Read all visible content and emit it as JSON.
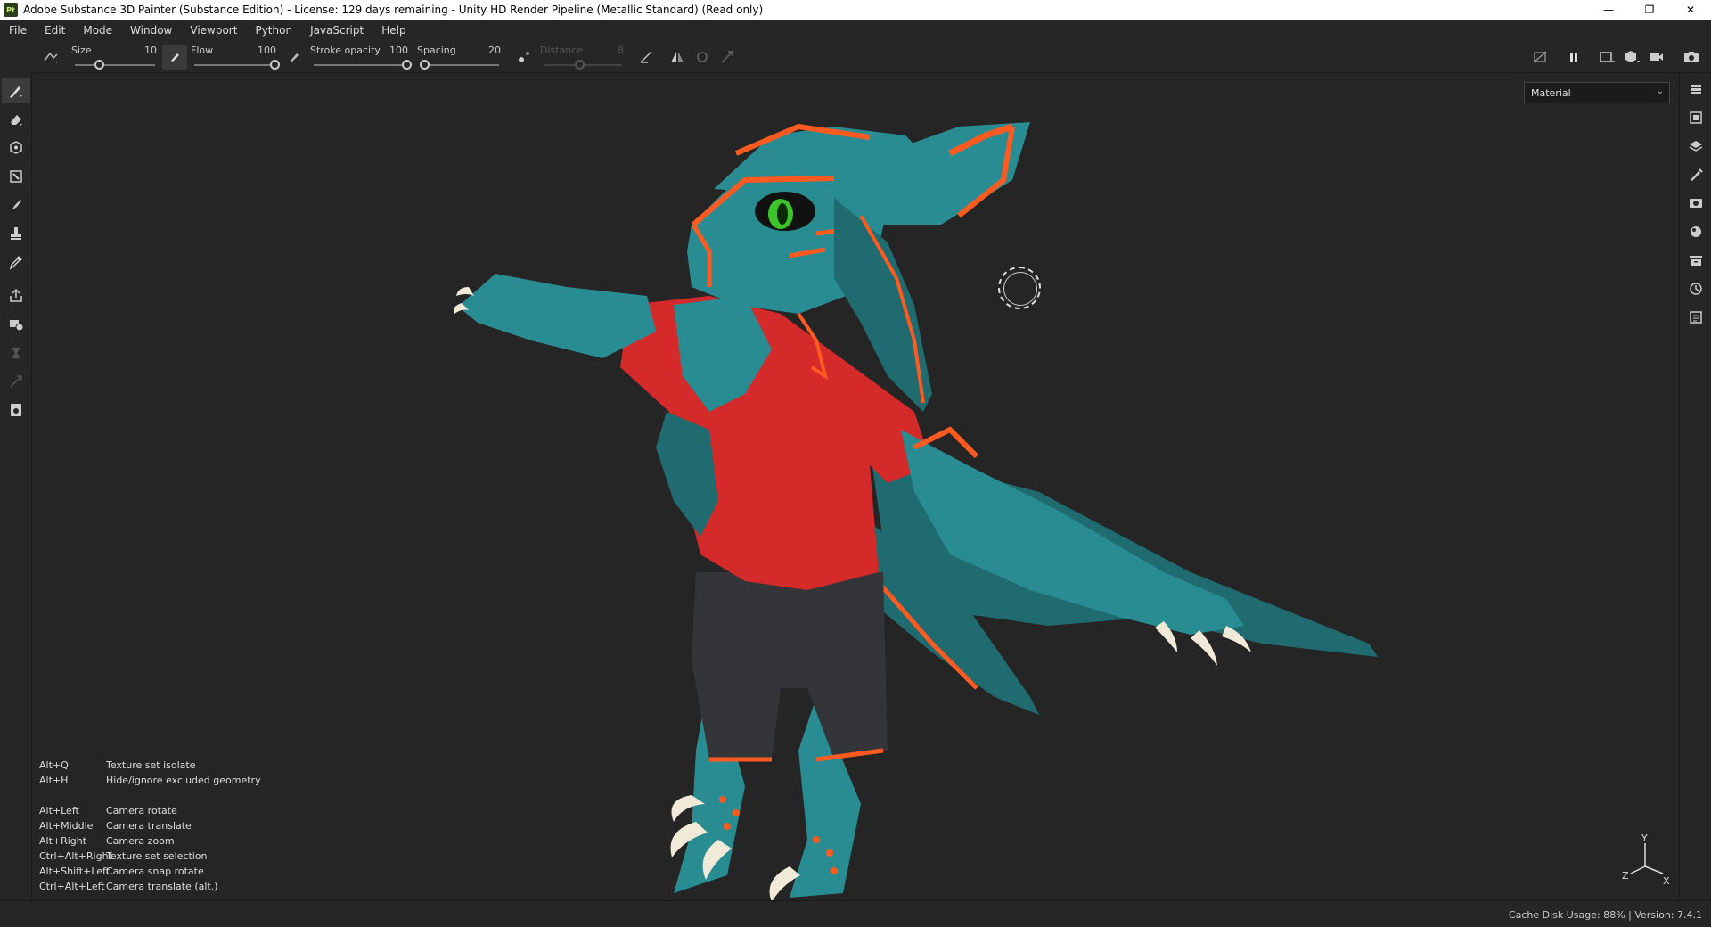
{
  "window": {
    "app_icon": "Pt",
    "title": "Adobe Substance 3D Painter (Substance Edition) - License: 129 days remaining - Unity HD Render Pipeline (Metallic Standard) (Read only)",
    "controls": {
      "minimize": "—",
      "restore": "❐",
      "close": "✕"
    }
  },
  "menu": [
    "File",
    "Edit",
    "Mode",
    "Window",
    "Viewport",
    "Python",
    "JavaScript",
    "Help"
  ],
  "toolbar": {
    "size": {
      "label": "Size",
      "value": "10",
      "fraction": 0.3
    },
    "flow": {
      "label": "Flow",
      "value": "100",
      "fraction": 1.0
    },
    "stroke_opacity": {
      "label": "Stroke opacity",
      "value": "100",
      "fraction": 1.0
    },
    "spacing": {
      "label": "Spacing",
      "value": "20",
      "fraction": 0.05
    },
    "distance": {
      "label": "Distance",
      "value": "8",
      "fraction": 0.45
    }
  },
  "viewport": {
    "mode": "Material",
    "shortcuts": [
      {
        "key": "Alt+Q",
        "action": "Texture set isolate"
      },
      {
        "key": "Alt+H",
        "action": "Hide/ignore excluded geometry"
      },
      null,
      {
        "key": "Alt+Left",
        "action": "Camera rotate"
      },
      {
        "key": "Alt+Middle",
        "action": "Camera translate"
      },
      {
        "key": "Alt+Right",
        "action": "Camera zoom"
      },
      {
        "key": "Ctrl+Alt+Right",
        "action": "Texture set selection"
      },
      {
        "key": "Alt+Shift+Left",
        "action": "Camera snap rotate"
      },
      {
        "key": "Ctrl+Alt+Left",
        "action": "Camera translate (alt.)"
      }
    ],
    "axis": {
      "x": "X",
      "y": "Y",
      "z": "Z"
    }
  },
  "status": {
    "text": "Cache Disk Usage:   88% | Version: 7.4.1"
  },
  "colors": {
    "fur": "#2a8c93",
    "fur_dark": "#1d6469",
    "stripe": "#ff5a1f",
    "shirt": "#d42a2a",
    "shorts": "#333538",
    "claw": "#f2ead8"
  }
}
